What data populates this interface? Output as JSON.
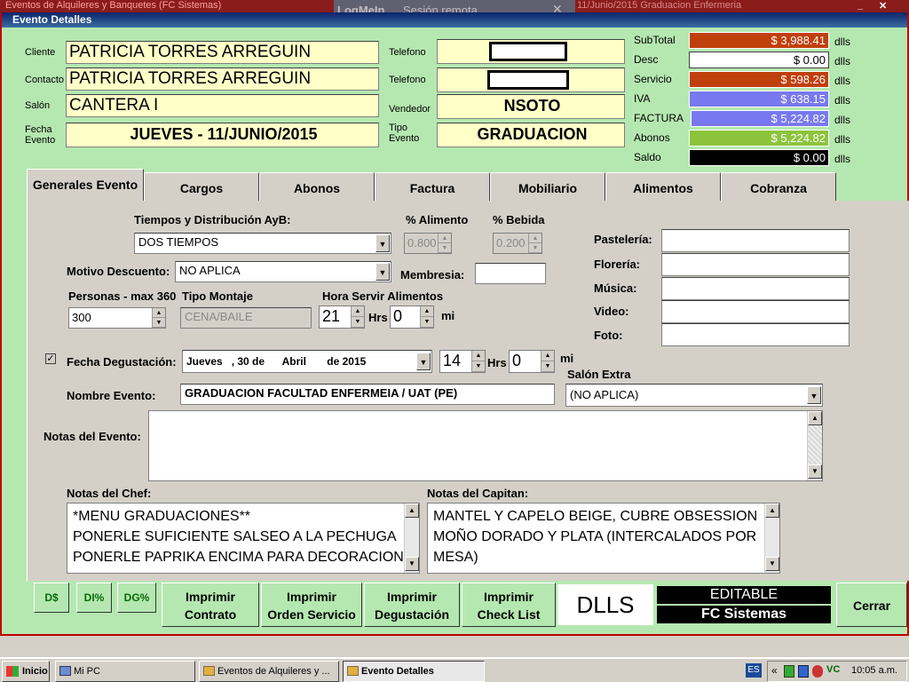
{
  "background": {
    "window_title": "Eventos de Alquileres y Banquetes (FC Sistemas)",
    "window_title_tail": "11/Junio/2015 Graduacion Enfermeria",
    "logmein_label": "LogMeIn",
    "logmein_sub": "Sesión remota"
  },
  "dialog": {
    "title": "Evento Detalles",
    "labels": {
      "cliente": "Cliente",
      "contacto": "Contacto",
      "salon": "Salón",
      "fecha_evento": "Fecha\nEvento",
      "telefono1": "Telefono",
      "telefono2": "Telefono",
      "vendedor": "Vendedor",
      "tipo_evento": "Tipo\nEvento"
    },
    "values": {
      "cliente": "PATRICIA TORRES ARREGUIN",
      "contacto": "PATRICIA TORRES ARREGUIN",
      "salon": "CANTERA I",
      "fecha_evento": "JUEVES  -  11/JUNIO/2015",
      "telefono1": "",
      "telefono2": "",
      "vendedor": "NSOTO",
      "tipo_evento": "GRADUACION"
    }
  },
  "totals": {
    "unit": "dlls",
    "rows": [
      {
        "label": "SubTotal",
        "value": "$ 3,988.41",
        "color": "#c0400c"
      },
      {
        "label": "Desc",
        "value": "$ 0.00",
        "color": "#ffffff"
      },
      {
        "label": "Servicio",
        "value": "$ 598.26",
        "color": "#c0400c"
      },
      {
        "label": "IVA",
        "value": "$ 638.15",
        "color": "#7878f0"
      },
      {
        "label": "FACTURA",
        "value": "$ 5,224.82",
        "color": "#7878f0"
      },
      {
        "label": "Abonos",
        "value": "$ 5,224.82",
        "color": "#8cc33c"
      },
      {
        "label": "Saldo",
        "value": "$ 0.00",
        "color": "#000000"
      }
    ]
  },
  "tabs": [
    "Generales Evento",
    "Cargos",
    "Abonos",
    "Factura",
    "Mobiliario",
    "Alimentos",
    "Cobranza"
  ],
  "general": {
    "tiempos_label": "Tiempos y Distribución AyB:",
    "tiempos_value": "DOS TIEMPOS",
    "alimento_label": "% Alimento",
    "alimento_value": "0.800",
    "bebida_label": "% Bebida",
    "bebida_value": "0.200",
    "motivo_label": "Motivo Descuento:",
    "motivo_value": "NO APLICA",
    "membresia_label": "Membresia:",
    "membresia_value": "",
    "personas_label": "Personas - max 360",
    "personas_value": "300",
    "montaje_label": "Tipo Montaje",
    "montaje_value": "CENA/BAILE",
    "hora_label": "Hora Servir Alimentos",
    "hora_hrs": "21",
    "hrs_label": "Hrs",
    "hora_min": "0",
    "mi_label": "mi",
    "degustacion_label": "Fecha Degustación:",
    "degustacion_value": "Jueves   , 30 de      Abril       de 2015",
    "deg_hrs": "14",
    "deg_min": "0",
    "salon_extra_label": "Salón Extra",
    "salon_extra_value": "(NO APLICA)",
    "nombre_label": "Nombre Evento:",
    "nombre_value": "GRADUACION FACULTAD ENFERMEIA / UAT  (PE)",
    "notas_evento_label": "Notas del Evento:",
    "pasteleria_label": "Pastelería:",
    "floreria_label": "Florería:",
    "musica_label": "Música:",
    "video_label": "Video:",
    "foto_label": "Foto:",
    "notas_chef_label": "Notas del Chef:",
    "notas_chef": [
      "*MENU GRADUACIONES**",
      "PONERLE SUFICIENTE SALSEO  A LA PECHUGA",
      "PONERLE  PAPRIKA ENCIMA PARA DECORACION"
    ],
    "notas_capitan_label": "Notas del Capitan:",
    "notas_capitan": [
      "MANTEL Y CAPELO BEIGE, CUBRE OBSESSION",
      "MOÑO DORADO Y PLATA (INTERCALADOS POR",
      "MESA)"
    ]
  },
  "footer": {
    "d_dollar": "D$",
    "di_pct": "DI%",
    "dg_pct": "DG%",
    "btn_contrato": [
      "Imprimir",
      "Contrato"
    ],
    "btn_orden": [
      "Imprimir",
      "Orden Servicio"
    ],
    "btn_degustacion": [
      "Imprimir",
      "Degustación"
    ],
    "btn_checklist": [
      "Imprimir",
      "Check List"
    ],
    "currency": "DLLS",
    "editable": "EDITABLE",
    "brand": "FC Sistemas",
    "cerrar": "Cerrar"
  },
  "taskbar": {
    "start": "Inicio",
    "tasks": [
      "Mi PC",
      "Eventos de Alquileres y ...",
      "Evento Detalles"
    ],
    "lang": "ES",
    "time": "10:05 a.m."
  }
}
